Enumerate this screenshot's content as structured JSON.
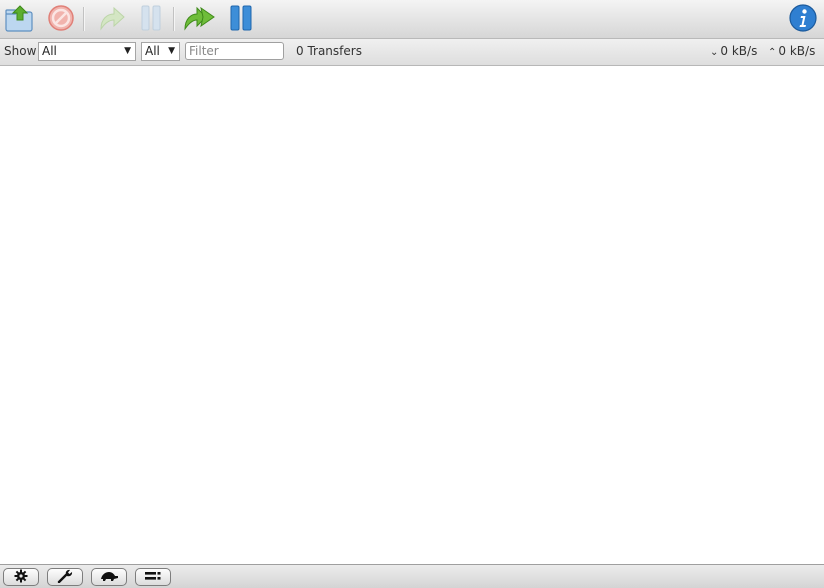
{
  "toolbar": {
    "buttons": [
      {
        "icon": "open-folder-icon",
        "enabled": true
      },
      {
        "icon": "remove-icon",
        "enabled": false
      },
      {
        "icon": "resume-icon",
        "enabled": false
      },
      {
        "icon": "pause-icon",
        "enabled": false
      },
      {
        "icon": "resume-all-icon",
        "enabled": true
      },
      {
        "icon": "pause-all-icon",
        "enabled": true
      },
      {
        "icon": "info-icon",
        "enabled": true
      }
    ]
  },
  "filterbar": {
    "show_label": "Show",
    "filter_mode_value": "All",
    "tracker_value": "All",
    "filter_placeholder": "Filter",
    "transfers_text": "0 Transfers",
    "download_speed": "0 kB/s",
    "upload_speed": "0 kB/s"
  },
  "footer": {
    "buttons": [
      "settings-icon",
      "wrench-icon",
      "turtle-icon",
      "sort-icon"
    ]
  },
  "colors": {
    "accent_blue": "#2f7fd1",
    "green": "#5cae2f",
    "red": "#d94a43"
  }
}
